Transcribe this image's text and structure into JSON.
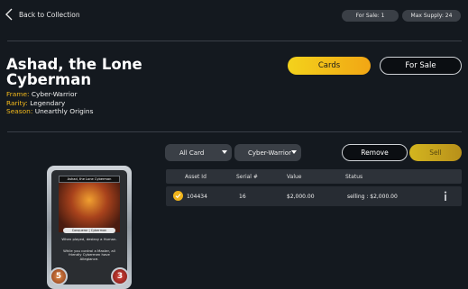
{
  "nav": {
    "back_label": "Back to Collection"
  },
  "stats": {
    "for_sale": "For Sale: 1",
    "max_supply": "Max Supply: 24"
  },
  "asset": {
    "name": "Ashad, the Lone Cyberman",
    "frame_label": "Frame:",
    "frame": "Cyber-Warrior",
    "rarity_label": "Rarity:",
    "rarity": "Legendary",
    "season_label": "Season:",
    "season": "Unearthly Origins"
  },
  "tabs": {
    "cards": "Cards",
    "for_sale": "For Sale"
  },
  "filters": {
    "card_filter": "All Card",
    "frame_filter": "Cyber-Warrior"
  },
  "actions": {
    "remove": "Remove",
    "sell": "Sell"
  },
  "table": {
    "columns": [
      "Asset Id",
      "Serial #",
      "Value",
      "Status"
    ],
    "rows": [
      {
        "asset_id": "104434",
        "serial": "16",
        "value": "$2,000.00",
        "status": "selling : $2,000.00"
      }
    ]
  },
  "card_art": {
    "title": "Ashad, the Lone Cyberman",
    "type_line": "Conqueror | Cyberman",
    "text1": "When played, destroy a Human.",
    "text2": "While you control a Master, all friendly Cybermen have Allegiance.",
    "cost": "5",
    "power": "3"
  },
  "colors": {
    "accent": "#f4ba1c",
    "background": "#14191f"
  }
}
